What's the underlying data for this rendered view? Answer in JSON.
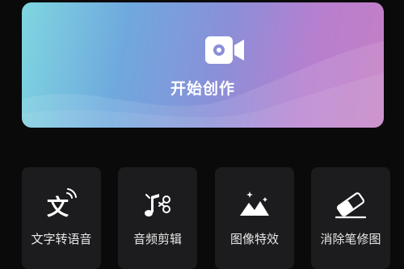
{
  "banner": {
    "label": "开始创作",
    "icon": "video-camera-icon",
    "gradient_colors": [
      "#7fd6e0",
      "#6fa9de",
      "#8b8fd8",
      "#c47fc4"
    ]
  },
  "tools": [
    {
      "label": "文字转语音",
      "icon": "text-to-speech-icon",
      "glyph": "文"
    },
    {
      "label": "音频剪辑",
      "icon": "audio-cut-icon"
    },
    {
      "label": "图像特效",
      "icon": "image-effects-icon"
    },
    {
      "label": "消除笔修图",
      "icon": "eraser-icon"
    }
  ],
  "colors": {
    "background": "#0a0a0a",
    "tile": "#1c1c1e",
    "text": "#e8e8e8"
  }
}
